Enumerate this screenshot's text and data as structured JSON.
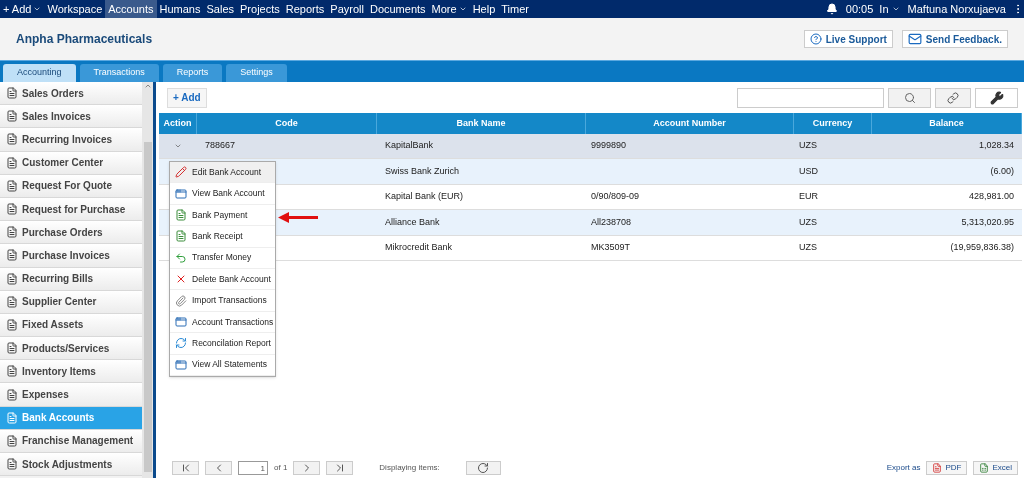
{
  "nav": {
    "items": [
      {
        "label": "+ Add",
        "selected": false,
        "has_menu": true
      },
      {
        "label": "Workspace",
        "selected": false,
        "has_menu": false
      },
      {
        "label": "Accounts",
        "selected": true,
        "has_menu": false
      },
      {
        "label": "Humans",
        "selected": false,
        "has_menu": false
      },
      {
        "label": "Sales",
        "selected": false,
        "has_menu": false
      },
      {
        "label": "Projects",
        "selected": false,
        "has_menu": false
      },
      {
        "label": "Reports",
        "selected": false,
        "has_menu": false
      },
      {
        "label": "Payroll",
        "selected": false,
        "has_menu": false
      },
      {
        "label": "Documents",
        "selected": false,
        "has_menu": false
      },
      {
        "label": "More",
        "selected": false,
        "has_menu": true
      },
      {
        "label": "Help",
        "selected": false,
        "has_menu": false
      },
      {
        "label": "Timer",
        "selected": false,
        "has_menu": false
      }
    ],
    "time": "00:05",
    "status": "In",
    "user": "Maftuna Norxujaeva"
  },
  "header": {
    "company": "Anpha Pharmaceuticals",
    "live_support": "Live Support",
    "feedback": "Send Feedback."
  },
  "tabs": [
    {
      "label": "Accounting",
      "selected": true
    },
    {
      "label": "Transactions",
      "selected": false
    },
    {
      "label": "Reports",
      "selected": false
    },
    {
      "label": "Settings",
      "selected": false
    }
  ],
  "sidebar": {
    "items": [
      {
        "label": "Sales Orders",
        "selected": false
      },
      {
        "label": "Sales Invoices",
        "selected": false
      },
      {
        "label": "Recurring Invoices",
        "selected": false
      },
      {
        "label": "Customer Center",
        "selected": false
      },
      {
        "label": "Request For Quote",
        "selected": false
      },
      {
        "label": "Request for Purchase",
        "selected": false
      },
      {
        "label": "Purchase Orders",
        "selected": false
      },
      {
        "label": "Purchase Invoices",
        "selected": false
      },
      {
        "label": "Recurring Bills",
        "selected": false
      },
      {
        "label": "Supplier Center",
        "selected": false
      },
      {
        "label": "Fixed Assets",
        "selected": false
      },
      {
        "label": "Products/Services",
        "selected": false
      },
      {
        "label": "Inventory Items",
        "selected": false
      },
      {
        "label": "Expenses",
        "selected": false
      },
      {
        "label": "Bank Accounts",
        "selected": true
      },
      {
        "label": "Franchise Management",
        "selected": false
      },
      {
        "label": "Stock Adjustments",
        "selected": false
      }
    ]
  },
  "toolbar": {
    "add": "+ Add"
  },
  "table": {
    "columns": [
      "Action",
      "Code",
      "Bank Name",
      "Account Number",
      "Currency",
      "Balance"
    ],
    "rows": [
      {
        "code": "788667",
        "bank_name": "KapitalBank",
        "account_number": "9999890",
        "currency": "UZS",
        "balance": "1,028.34",
        "selected": true
      },
      {
        "bank_name": "Swiss Bank Zurich",
        "currency": "USD",
        "balance": "(6.00)",
        "selected": false
      },
      {
        "bank_name": "Kapital Bank (EUR)",
        "account_number": "0/90/809-09",
        "currency": "EUR",
        "balance": "428,981.00",
        "selected": false
      },
      {
        "bank_name": "Alliance Bank",
        "account_number": "All238708",
        "currency": "UZS",
        "balance": "5,313,020.95",
        "selected": false
      },
      {
        "bank_name": "Mikrocredit Bank",
        "account_number": "MK3509T",
        "currency": "UZS",
        "balance": "(19,959,836.38)",
        "selected": false
      }
    ]
  },
  "action_menu": {
    "items": [
      {
        "label": "Edit Bank Account",
        "kind": "edit",
        "selected": true
      },
      {
        "label": "View Bank Account",
        "kind": "window",
        "selected": false
      },
      {
        "label": "Bank Payment",
        "kind": "doc",
        "selected": false
      },
      {
        "label": "Bank Receipt",
        "kind": "doc",
        "selected": false
      },
      {
        "label": "Transfer Money",
        "kind": "transfer",
        "selected": false
      },
      {
        "label": "Delete Bank Account",
        "kind": "delete",
        "selected": false
      },
      {
        "label": "Import Transactions",
        "kind": "clip",
        "selected": false
      },
      {
        "label": "Account Transactions",
        "kind": "window",
        "selected": false
      },
      {
        "label": "Reconcilation Report",
        "kind": "refresh",
        "selected": false
      },
      {
        "label": "View All Statements",
        "kind": "window",
        "selected": false
      }
    ]
  },
  "pagination": {
    "page": "1",
    "of": "of 1",
    "displaying": "Displaying items:",
    "export_label": "Export as",
    "pdf": "PDF",
    "excel": "Excel"
  }
}
